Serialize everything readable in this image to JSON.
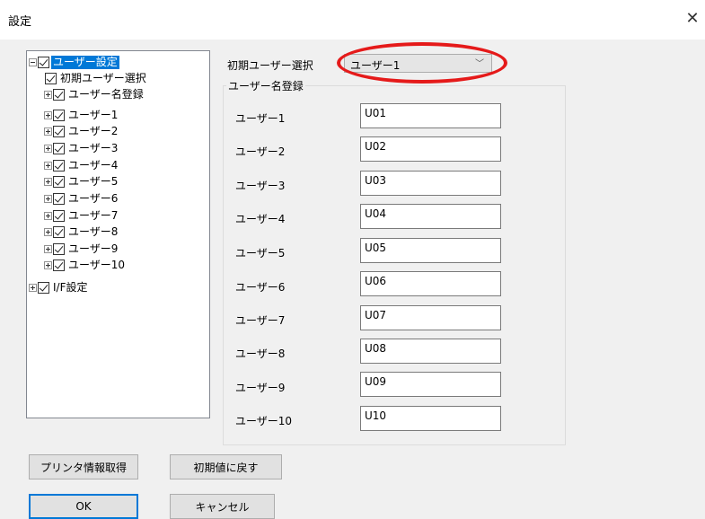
{
  "window": {
    "title": "設定",
    "close_icon": "close-icon"
  },
  "tree": {
    "root": {
      "label": "ユーザー設定",
      "checked": true
    },
    "items": [
      {
        "label": "初期ユーザー選択",
        "checked": true
      },
      {
        "label": "ユーザー名登録",
        "checked": true
      },
      {
        "label": "ユーザー1",
        "checked": true
      },
      {
        "label": "ユーザー2",
        "checked": true
      },
      {
        "label": "ユーザー3",
        "checked": true
      },
      {
        "label": "ユーザー4",
        "checked": true
      },
      {
        "label": "ユーザー5",
        "checked": true
      },
      {
        "label": "ユーザー6",
        "checked": true
      },
      {
        "label": "ユーザー7",
        "checked": true
      },
      {
        "label": "ユーザー8",
        "checked": true
      },
      {
        "label": "ユーザー9",
        "checked": true
      },
      {
        "label": "ユーザー10",
        "checked": true
      }
    ],
    "second_root": {
      "label": "I/F設定",
      "checked": true
    }
  },
  "initial_user": {
    "label": "初期ユーザー選択",
    "selected": "ユーザー1"
  },
  "user_names": {
    "group_title": "ユーザー名登録",
    "rows": [
      {
        "label": "ユーザー1",
        "value": "U01"
      },
      {
        "label": "ユーザー2",
        "value": "U02"
      },
      {
        "label": "ユーザー3",
        "value": "U03"
      },
      {
        "label": "ユーザー4",
        "value": "U04"
      },
      {
        "label": "ユーザー5",
        "value": "U05"
      },
      {
        "label": "ユーザー6",
        "value": "U06"
      },
      {
        "label": "ユーザー7",
        "value": "U07"
      },
      {
        "label": "ユーザー8",
        "value": "U08"
      },
      {
        "label": "ユーザー9",
        "value": "U09"
      },
      {
        "label": "ユーザー10",
        "value": "U10"
      }
    ]
  },
  "buttons": {
    "printer_info": "プリンタ情報取得",
    "reset_defaults": "初期値に戻す",
    "ok": "OK",
    "cancel": "キャンセル"
  },
  "colors": {
    "selection": "#0078d7",
    "highlight_ellipse": "#e51a1a"
  }
}
